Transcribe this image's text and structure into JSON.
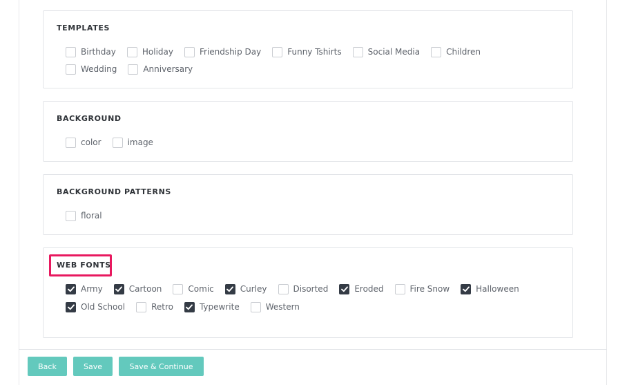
{
  "sections": {
    "templates": {
      "title": "TEMPLATES",
      "rows": [
        [
          {
            "label": "Birthday",
            "checked": false
          },
          {
            "label": "Holiday",
            "checked": false
          },
          {
            "label": "Friendship Day",
            "checked": false
          },
          {
            "label": "Funny Tshirts",
            "checked": false
          },
          {
            "label": "Social Media",
            "checked": false
          },
          {
            "label": "Children",
            "checked": false
          }
        ],
        [
          {
            "label": "Wedding",
            "checked": false
          },
          {
            "label": "Anniversary",
            "checked": false
          }
        ]
      ]
    },
    "background": {
      "title": "BACKGROUND",
      "rows": [
        [
          {
            "label": "color",
            "checked": false
          },
          {
            "label": "image",
            "checked": false
          }
        ]
      ]
    },
    "background_patterns": {
      "title": "BACKGROUND PATTERNS",
      "rows": [
        [
          {
            "label": "floral",
            "checked": false
          }
        ]
      ]
    },
    "web_fonts": {
      "title": "WEB FONTS",
      "rows": [
        [
          {
            "label": "Army",
            "checked": true
          },
          {
            "label": "Cartoon",
            "checked": true
          },
          {
            "label": "Comic",
            "checked": false
          },
          {
            "label": "Curley",
            "checked": true
          },
          {
            "label": "Disorted",
            "checked": false
          },
          {
            "label": "Eroded",
            "checked": true
          },
          {
            "label": "Fire Snow",
            "checked": false
          },
          {
            "label": "Halloween",
            "checked": true
          }
        ],
        [
          {
            "label": "Old School",
            "checked": true
          },
          {
            "label": "Retro",
            "checked": false
          },
          {
            "label": "Typewrite",
            "checked": true
          },
          {
            "label": "Western",
            "checked": false
          }
        ]
      ]
    }
  },
  "footer": {
    "back_label": "Back",
    "save_label": "Save",
    "save_continue_label": "Save & Continue"
  },
  "colors": {
    "accent": "#63c9bd",
    "highlight": "#e8195f",
    "checked": "#343b45"
  }
}
